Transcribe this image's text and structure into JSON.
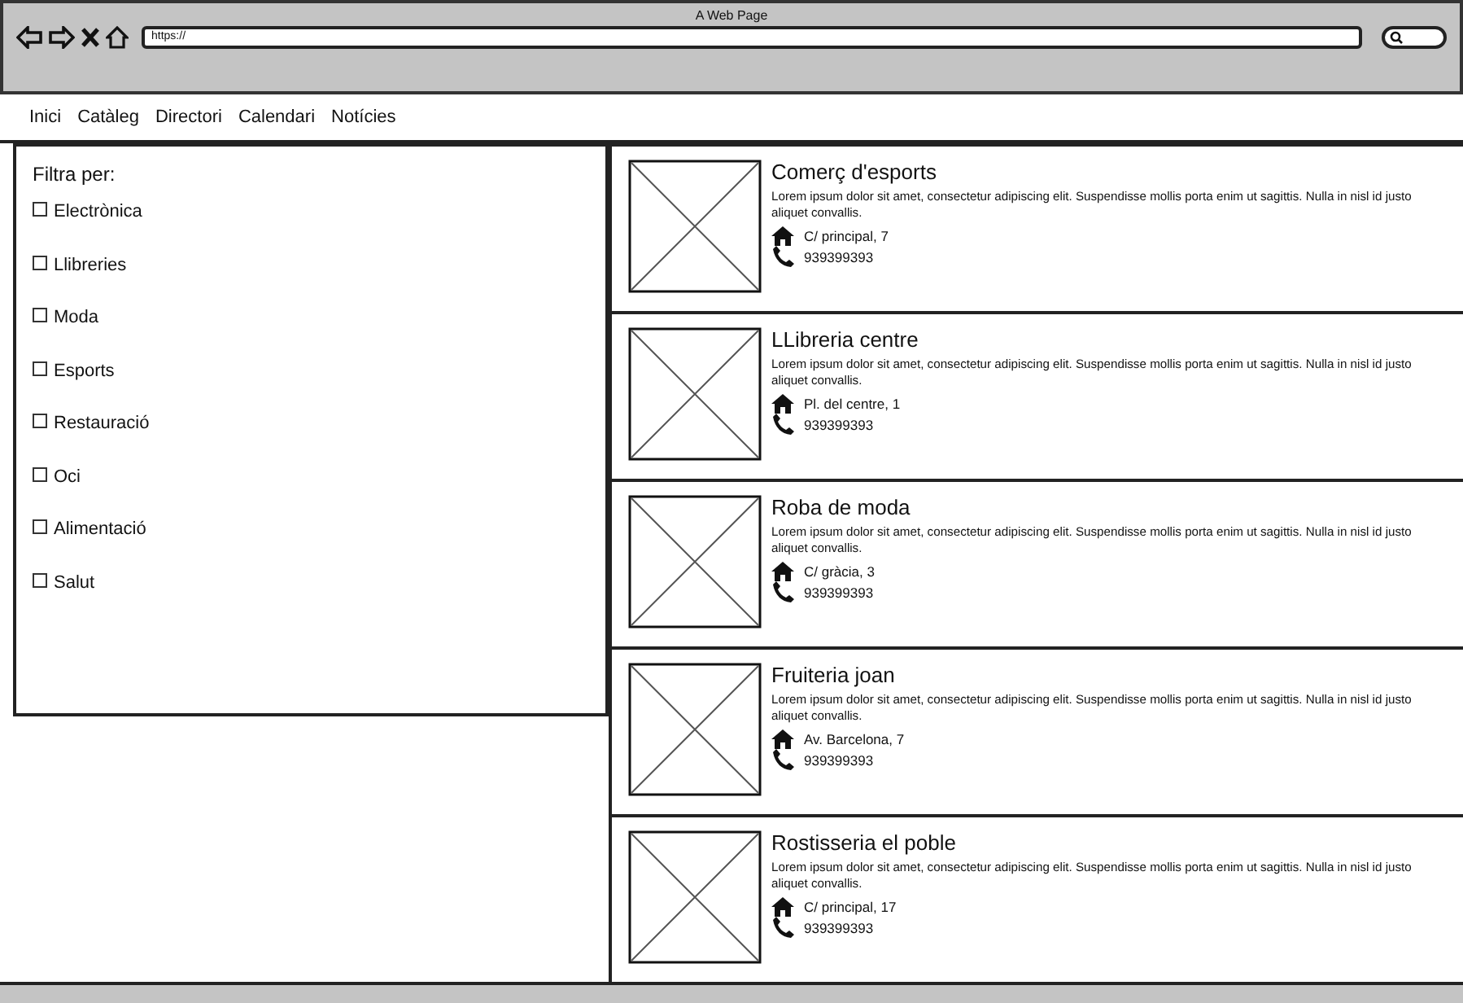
{
  "window": {
    "title": "A Web Page"
  },
  "address_bar": {
    "value": "https://"
  },
  "nav_menu": [
    {
      "label": "Inici"
    },
    {
      "label": "Catàleg"
    },
    {
      "label": "Directori"
    },
    {
      "label": "Calendari"
    },
    {
      "label": "Notícies"
    }
  ],
  "filter_panel": {
    "title": "Filtra per:",
    "options": [
      {
        "label": "Electrònica",
        "checked": false
      },
      {
        "label": "Llibreries",
        "checked": false
      },
      {
        "label": "Moda",
        "checked": false
      },
      {
        "label": "Esports",
        "checked": false
      },
      {
        "label": "Restauració",
        "checked": false
      },
      {
        "label": "Oci",
        "checked": false
      },
      {
        "label": "Alimentació",
        "checked": false
      },
      {
        "label": "Salut",
        "checked": false
      }
    ]
  },
  "listings": [
    {
      "name": "Comerç d'esports",
      "description": "Lorem ipsum dolor sit amet, consectetur adipiscing elit. Suspendisse mollis porta enim ut sagittis. Nulla in nisl id justo aliquet convallis.",
      "address": "C/ principal, 7",
      "phone": "939399393"
    },
    {
      "name": "LLibreria centre",
      "description": "Lorem ipsum dolor sit amet, consectetur adipiscing elit. Suspendisse mollis porta enim ut sagittis. Nulla in nisl id justo aliquet convallis.",
      "address": "Pl. del centre, 1",
      "phone": "939399393"
    },
    {
      "name": "Roba de moda",
      "description": "Lorem ipsum dolor sit amet, consectetur adipiscing elit. Suspendisse mollis porta enim ut sagittis. Nulla in nisl id justo aliquet convallis.",
      "address": "C/ gràcia, 3",
      "phone": "939399393"
    },
    {
      "name": "Fruiteria joan",
      "description": "Lorem ipsum dolor sit amet, consectetur adipiscing elit. Suspendisse mollis porta enim ut sagittis. Nulla in nisl id justo aliquet convallis.",
      "address": "Av. Barcelona, 7",
      "phone": "939399393"
    },
    {
      "name": "Rostisseria el poble",
      "description": "Lorem ipsum dolor sit amet, consectetur adipiscing elit. Suspendisse mollis porta enim ut sagittis. Nulla in nisl id justo aliquet convallis.",
      "address": "C/ principal, 17",
      "phone": "939399393"
    }
  ]
}
